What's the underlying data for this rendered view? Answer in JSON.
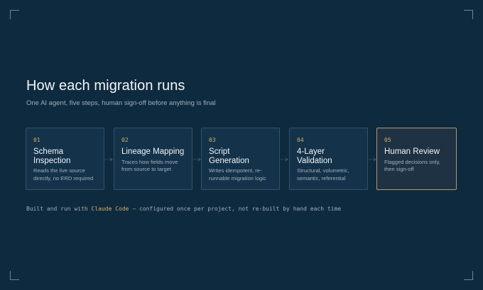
{
  "header": {
    "title": "How each migration runs",
    "subtitle": "One AI agent, five steps, human sign-off before anything is final"
  },
  "steps": [
    {
      "num": "01",
      "name": "Schema Inspection",
      "desc": "Reads the live source directly, no ERD required"
    },
    {
      "num": "02",
      "name": "Lineage Mapping",
      "desc": "Traces how fields move from source to target"
    },
    {
      "num": "03",
      "name": "Script Generation",
      "desc": "Writes idempotent, re-runnable migration logic"
    },
    {
      "num": "04",
      "name": "4-Layer Validation",
      "desc": "Structural, volumetric, semantic, referential"
    },
    {
      "num": "05",
      "name": "Human Review",
      "desc": "Flagged decisions only, then sign-off"
    }
  ],
  "footer": {
    "prefix": "Built and run with ",
    "highlight": "Claude Code",
    "suffix": " — configured once per project, not re-built by hand each time"
  },
  "colors": {
    "background": "#0e2a3e",
    "card": "#14324a",
    "card_border": "#33516a",
    "accent": "#d9ad62",
    "highlight_border": "#b99664"
  }
}
